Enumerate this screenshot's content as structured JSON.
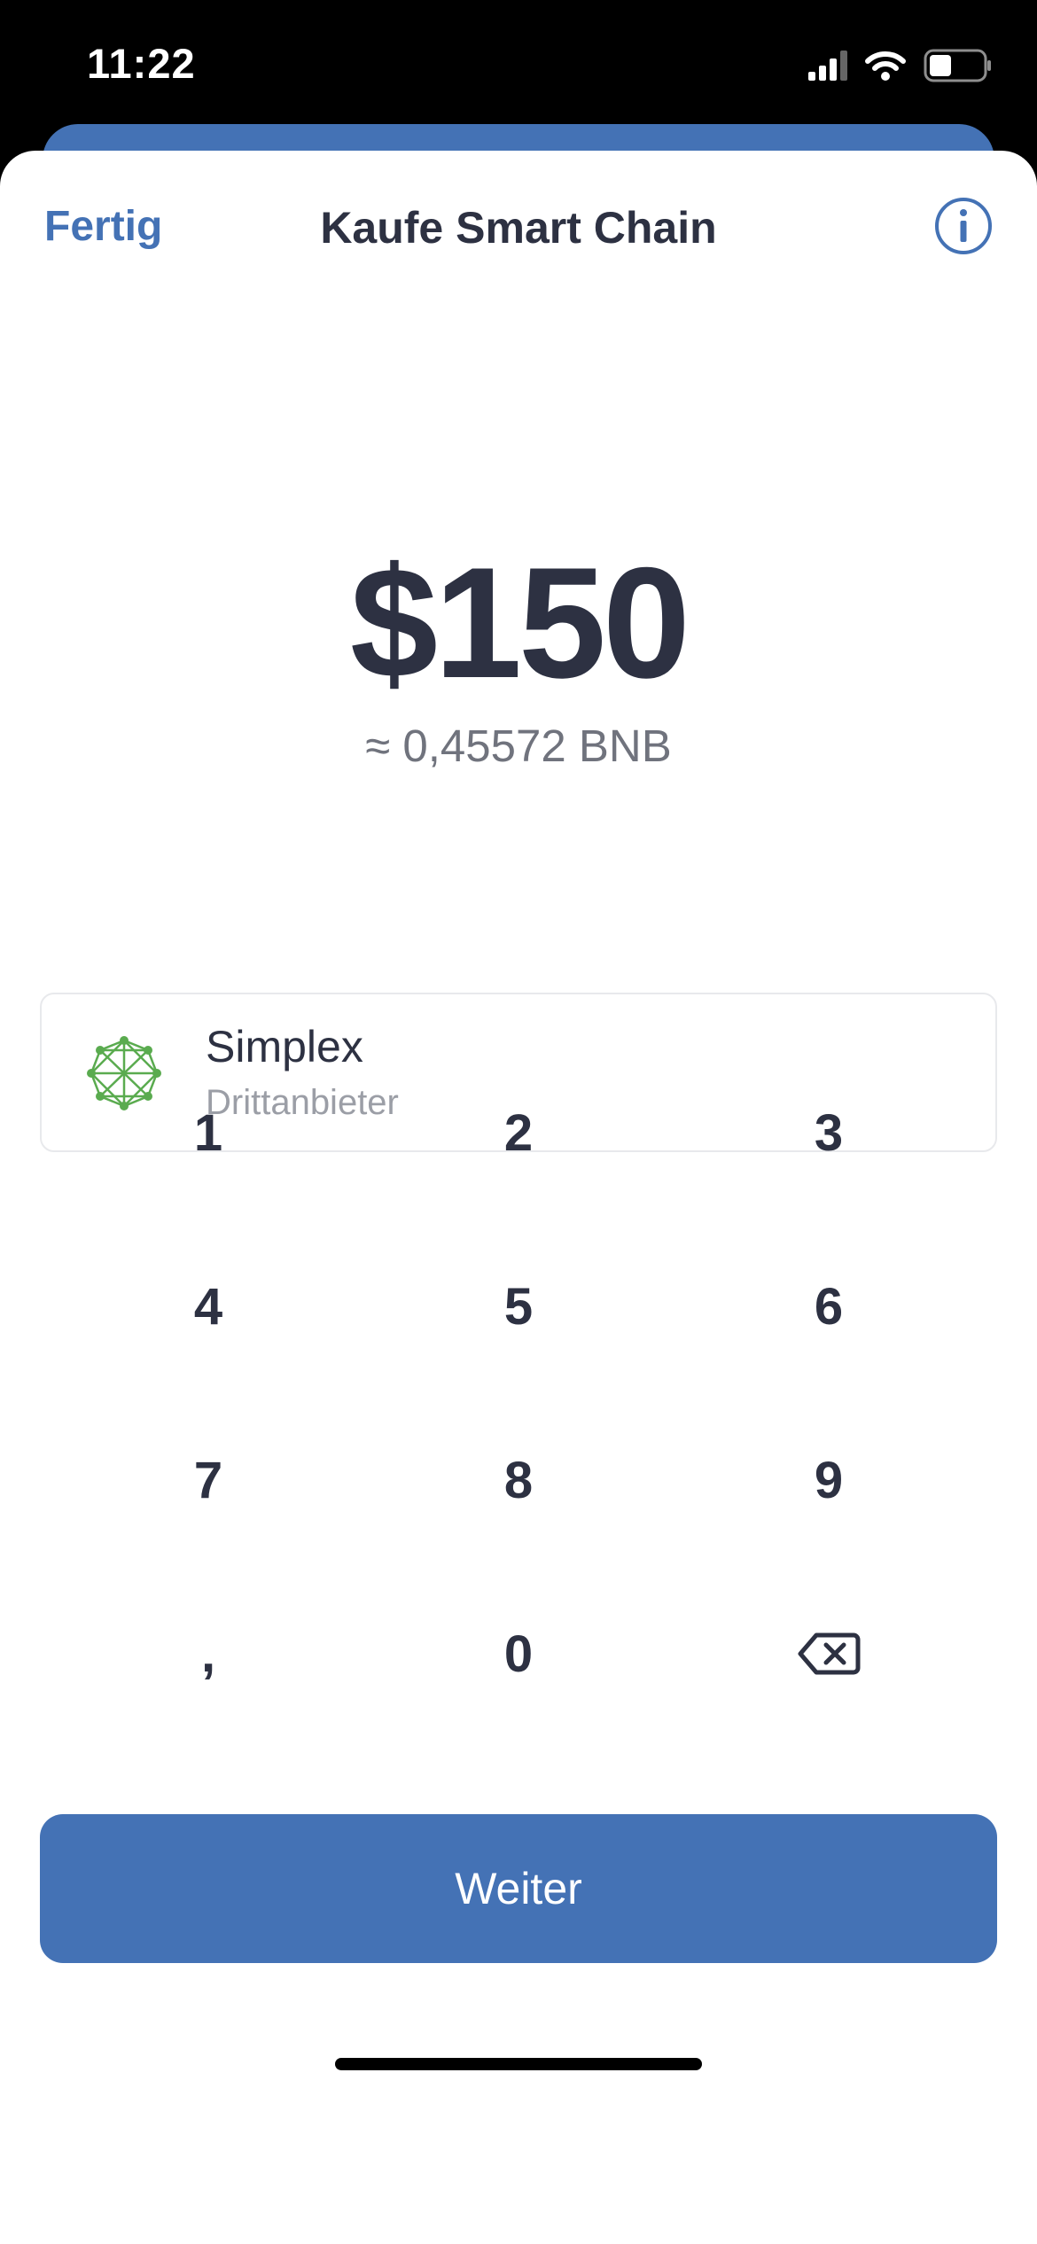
{
  "status": {
    "time": "11:22"
  },
  "nav": {
    "done_label": "Fertig",
    "title": "Kaufe Smart Chain",
    "info_icon": "info-circle-icon"
  },
  "amount": {
    "value": "$150",
    "converted": "≈ 0,45572 BNB"
  },
  "provider": {
    "name": "Simplex",
    "subtitle": "Drittanbieter",
    "icon": "simplex-network-icon"
  },
  "keypad": {
    "keys": [
      "1",
      "2",
      "3",
      "4",
      "5",
      "6",
      "7",
      "8",
      "9",
      ",",
      "0"
    ],
    "delete_icon": "backspace-icon"
  },
  "actions": {
    "continue_label": "Weiter"
  },
  "colors": {
    "accent": "#4472b5",
    "text": "#2d3142",
    "muted": "#9b9ea6",
    "provider_green": "#5aab4f"
  }
}
